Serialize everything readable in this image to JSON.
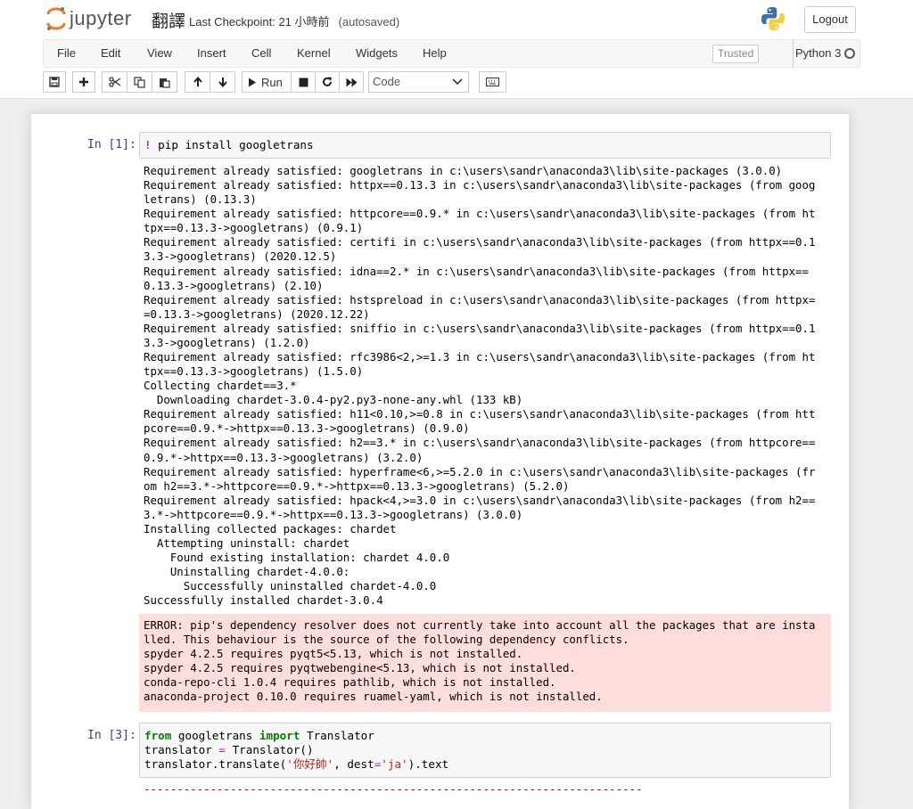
{
  "header": {
    "brand": "jupyter",
    "notebook_name": "翻譯",
    "checkpoint": "Last Checkpoint: 21 小時前",
    "autosaved": "(autosaved)",
    "logout_label": "Logout"
  },
  "menu": {
    "items": [
      "File",
      "Edit",
      "View",
      "Insert",
      "Cell",
      "Kernel",
      "Widgets",
      "Help"
    ],
    "trusted": "Trusted",
    "kernel": "Python 3"
  },
  "toolbar": {
    "run_label": "Run",
    "cell_type": "Code"
  },
  "cells": [
    {
      "prompt": "In [1]:",
      "code_bang": "!",
      "code_rest": " pip install googletrans",
      "stdout": [
        "Requirement already satisfied: googletrans in c:\\users\\sandr\\anaconda3\\lib\\site-packages (3.0.0)",
        "Requirement already satisfied: httpx==0.13.3 in c:\\users\\sandr\\anaconda3\\lib\\site-packages (from goog",
        "letrans) (0.13.3)",
        "Requirement already satisfied: httpcore==0.9.* in c:\\users\\sandr\\anaconda3\\lib\\site-packages (from ht",
        "tpx==0.13.3->googletrans) (0.9.1)",
        "Requirement already satisfied: certifi in c:\\users\\sandr\\anaconda3\\lib\\site-packages (from httpx==0.1",
        "3.3->googletrans) (2020.12.5)",
        "Requirement already satisfied: idna==2.* in c:\\users\\sandr\\anaconda3\\lib\\site-packages (from httpx==",
        "0.13.3->googletrans) (2.10)",
        "Requirement already satisfied: hstspreload in c:\\users\\sandr\\anaconda3\\lib\\site-packages (from httpx=",
        "=0.13.3->googletrans) (2020.12.22)",
        "Requirement already satisfied: sniffio in c:\\users\\sandr\\anaconda3\\lib\\site-packages (from httpx==0.1",
        "3.3->googletrans) (1.2.0)",
        "Requirement already satisfied: rfc3986<2,>=1.3 in c:\\users\\sandr\\anaconda3\\lib\\site-packages (from ht",
        "tpx==0.13.3->googletrans) (1.5.0)",
        "Collecting chardet==3.*",
        "  Downloading chardet-3.0.4-py2.py3-none-any.whl (133 kB)",
        "Requirement already satisfied: h11<0.10,>=0.8 in c:\\users\\sandr\\anaconda3\\lib\\site-packages (from htt",
        "pcore==0.9.*->httpx==0.13.3->googletrans) (0.9.0)",
        "Requirement already satisfied: h2==3.* in c:\\users\\sandr\\anaconda3\\lib\\site-packages (from httpcore==",
        "0.9.*->httpx==0.13.3->googletrans) (3.2.0)",
        "Requirement already satisfied: hyperframe<6,>=5.2.0 in c:\\users\\sandr\\anaconda3\\lib\\site-packages (fr",
        "om h2==3.*->httpcore==0.9.*->httpx==0.13.3->googletrans) (5.2.0)",
        "Requirement already satisfied: hpack<4,>=3.0 in c:\\users\\sandr\\anaconda3\\lib\\site-packages (from h2==",
        "3.*->httpcore==0.9.*->httpx==0.13.3->googletrans) (3.0.0)",
        "Installing collected packages: chardet",
        "  Attempting uninstall: chardet",
        "    Found existing installation: chardet 4.0.0",
        "    Uninstalling chardet-4.0.0:",
        "      Successfully uninstalled chardet-4.0.0",
        "Successfully installed chardet-3.0.4"
      ],
      "stderr": [
        "ERROR: pip's dependency resolver does not currently take into account all the packages that are insta",
        "lled. This behaviour is the source of the following dependency conflicts.",
        "spyder 4.2.5 requires pyqt5<5.13, which is not installed.",
        "spyder 4.2.5 requires pyqtwebengine<5.13, which is not installed.",
        "conda-repo-cli 1.0.4 requires pathlib, which is not installed.",
        "anaconda-project 0.10.0 requires ruamel-yaml, which is not installed."
      ]
    },
    {
      "prompt": "In [3]:",
      "code": {
        "l1_kw1": "from",
        "l1_mod": " googletrans ",
        "l1_kw2": "import",
        "l1_name": " Translator",
        "l2_a": "translator ",
        "l2_op": "=",
        "l2_b": " Translator()",
        "l3_a": "translator.translate(",
        "l3_s1": "'你好帥'",
        "l3_b": ", dest",
        "l3_op": "=",
        "l3_s2": "'ja'",
        "l3_c": ").text"
      },
      "error_rule": "---------------------------------------------------------------------------"
    }
  ]
}
